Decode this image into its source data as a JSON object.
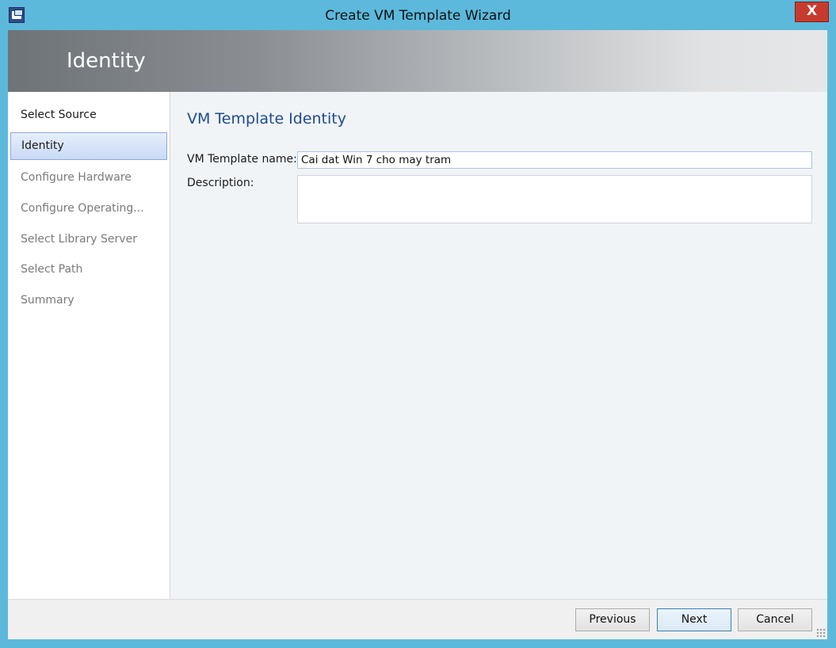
{
  "window": {
    "title": "Create VM Template Wizard",
    "close_label": "X"
  },
  "banner": {
    "title": "Identity"
  },
  "nav": {
    "items": [
      {
        "label": "Select Source",
        "state": "done"
      },
      {
        "label": "Identity",
        "state": "active"
      },
      {
        "label": "Configure Hardware",
        "state": "pending"
      },
      {
        "label": "Configure Operating...",
        "state": "pending"
      },
      {
        "label": "Select Library Server",
        "state": "pending"
      },
      {
        "label": "Select Path",
        "state": "pending"
      },
      {
        "label": "Summary",
        "state": "pending"
      }
    ]
  },
  "main": {
    "section_title": "VM Template Identity",
    "name_label": "VM Template name:",
    "name_value": "Cai dat Win 7 cho may tram",
    "description_label": "Description:",
    "description_value": ""
  },
  "footer": {
    "previous_label": "Previous",
    "next_label": "Next",
    "cancel_label": "Cancel"
  },
  "colors": {
    "frame": "#5cb9dc",
    "close": "#c73b2e",
    "section_title": "#1e4b8f",
    "active_nav": "#c9daf5"
  }
}
